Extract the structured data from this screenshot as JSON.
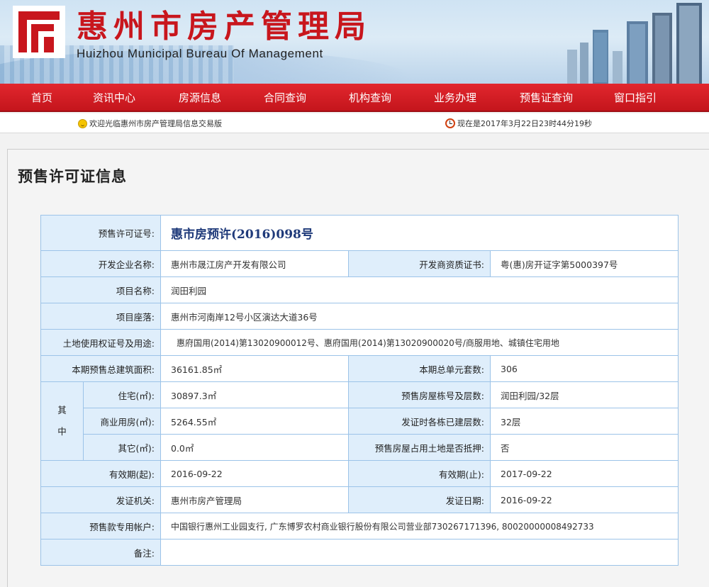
{
  "header": {
    "title_cn": "惠州市房产管理局",
    "title_en": "Huizhou Municipal Bureau Of Management"
  },
  "nav": {
    "items": [
      "首页",
      "资讯中心",
      "房源信息",
      "合同查询",
      "机构查询",
      "业务办理",
      "预售证查询",
      "窗口指引"
    ]
  },
  "infobar": {
    "welcome": "欢迎光临惠州市房产管理局信息交易版",
    "datetime": "现在是2017年3月22日23时44分19秒"
  },
  "page_title": "预售许可证信息",
  "permit": {
    "permit_no_label": "预售许可证号:",
    "permit_no": "惠市房预许(2016)098号",
    "developer_label": "开发企业名称:",
    "developer": "惠州市晟江房产开发有限公司",
    "qualification_label": "开发商资质证书:",
    "qualification": "粤(惠)房开证字第5000397号",
    "project_label": "项目名称:",
    "project": "润田利园",
    "location_label": "项目座落:",
    "location": "惠州市河南岸12号小区演达大道36号",
    "land_label": "土地使用权证号及用途:",
    "land": "惠府国用(2014)第13020900012号、惠府国用(2014)第13020900020号/商服用地、城镇住宅用地",
    "area_label": "本期预售总建筑面积:",
    "area": "36161.85㎡",
    "units_label": "本期总单元套数:",
    "units": "306",
    "among_label": "其中",
    "residential_label": "住宅(㎡):",
    "residential": "30897.3㎡",
    "buildings_label": "预售房屋栋号及层数:",
    "buildings": "润田利园/32层",
    "commercial_label": "商业用房(㎡):",
    "commercial": "5264.55㎡",
    "floors_built_label": "发证时各栋已建层数:",
    "floors_built": "32层",
    "other_label": "其它(㎡):",
    "other": "0.0㎡",
    "mortgage_label": "预售房屋占用土地是否抵押:",
    "mortgage": "否",
    "valid_from_label": "有效期(起):",
    "valid_from": "2016-09-22",
    "valid_to_label": "有效期(止):",
    "valid_to": "2017-09-22",
    "authority_label": "发证机关:",
    "authority": "惠州市房产管理局",
    "issue_date_label": "发证日期:",
    "issue_date": "2016-09-22",
    "account_label": "预售款专用帐户:",
    "account": "中国银行惠州工业园支行, 广东博罗农村商业银行股份有限公司营业部730267171396, 80020000008492733",
    "remark_label": "备注:",
    "remark": ""
  }
}
